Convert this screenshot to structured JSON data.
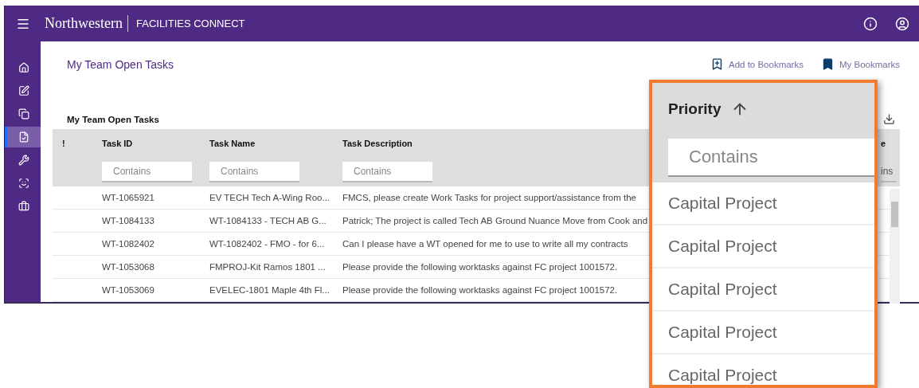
{
  "header": {
    "brand": "Northwestern",
    "product": "FACILITIES CONNECT"
  },
  "sidebar": {
    "items": [
      {
        "kind": "home",
        "selected": false
      },
      {
        "kind": "edit",
        "selected": false
      },
      {
        "kind": "copy",
        "selected": false
      },
      {
        "kind": "tasks",
        "selected": true
      },
      {
        "kind": "wrench",
        "selected": false
      },
      {
        "kind": "scan",
        "selected": false
      },
      {
        "kind": "briefcase",
        "selected": false
      }
    ]
  },
  "page": {
    "title": "My Team Open Tasks",
    "actions": [
      {
        "kind": "add-bookmark",
        "label": "Add to Bookmarks"
      },
      {
        "kind": "bookmarks",
        "label": "My Bookmarks"
      }
    ]
  },
  "section": {
    "title": "My Team Open Tasks"
  },
  "table": {
    "columns": [
      {
        "label": "!"
      },
      {
        "label": "Task ID",
        "placeholder": "Contains"
      },
      {
        "label": "Task Name",
        "placeholder": "Contains"
      },
      {
        "label": "Task Description",
        "placeholder": "Contains"
      },
      {
        "label": "e",
        "placeholder": "ins"
      }
    ],
    "rows": [
      [
        "",
        "WT-1065921",
        "EV TECH Tech A-Wing Roo...",
        "FMCS, please create Work Tasks for project support/assistance from the"
      ],
      [
        "",
        "WT-1084133",
        "WT-1084133 - TECH AB G...",
        "Patrick; The project is called Tech AB Ground Nuance Move from Cook and"
      ],
      [
        "",
        "WT-1082402",
        "WT-1082402 - FMO - for 6...",
        "Can I please have a WT opened for me to use to write all my contracts"
      ],
      [
        "",
        "WT-1053068",
        "FMPROJ-Kit Ramos 1801 ...",
        "Please provide the following worktasks against FC project 1001572."
      ],
      [
        "",
        "WT-1053069",
        "EVELEC-1801 Maple 4th Fl...",
        "Please provide the following worktasks against FC project 1001572."
      ]
    ]
  },
  "callout": {
    "column": "Priority",
    "placeholder": "Contains",
    "values": [
      "Capital Project",
      "Capital Project",
      "Capital Project",
      "Capital Project",
      "Capital Project"
    ]
  }
}
